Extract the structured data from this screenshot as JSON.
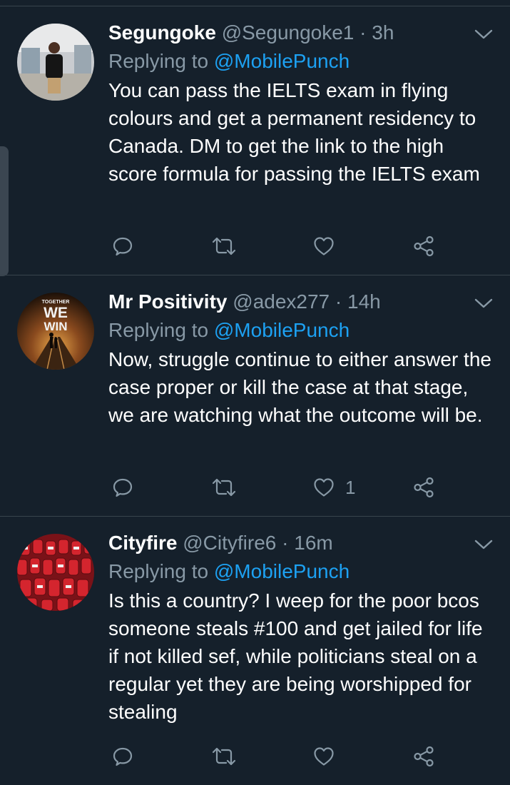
{
  "tweets": [
    {
      "name": "Segungoke",
      "handle": "@Segungoke1",
      "separator": "·",
      "time": "3h",
      "replying_prefix": "Replying to",
      "replying_to": "@MobilePunch",
      "text": "You can pass the IELTS exam in flying colours and get a permanent residency to Canada. DM to get the link to the high score formula for passing the IELTS exam",
      "likes": ""
    },
    {
      "name": "Mr Positivity",
      "handle": "@adex277",
      "separator": "·",
      "time": "14h",
      "replying_prefix": "Replying to",
      "replying_to": "@MobilePunch",
      "text": "Now, struggle continue to either answer the case proper or kill the case at that stage, we are watching what the outcome will be.",
      "likes": "1",
      "avatar_text": {
        "small": "TOGETHER",
        "big1": "WE",
        "big2": "WIN"
      }
    },
    {
      "name": "Cityfire",
      "handle": "@Cityfire6",
      "separator": "·",
      "time": "16m",
      "replying_prefix": "Replying to",
      "replying_to": "@MobilePunch",
      "text": "Is this a country? I weep for the poor bcos someone steals #100 and get jailed for life if not killed sef, while politicians steal on a regular yet they are being worshipped for stealing",
      "likes": ""
    }
  ],
  "icons": {
    "reply": "reply-icon",
    "retweet": "retweet-icon",
    "like": "heart-icon",
    "share": "share-icon",
    "more": "chevron-down-icon"
  },
  "colors": {
    "background": "#15202b",
    "divider": "#38444d",
    "secondary_text": "#8899a6",
    "link": "#1da1f2",
    "primary_text": "#ffffff"
  }
}
